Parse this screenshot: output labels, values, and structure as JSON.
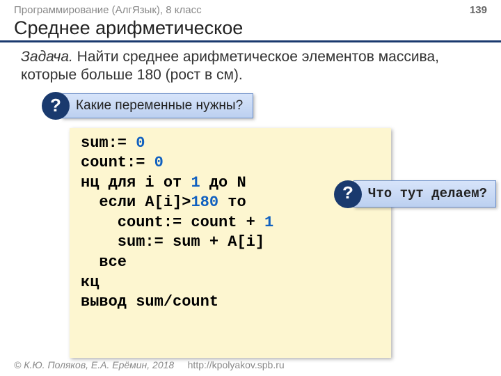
{
  "header": {
    "course": "Программирование (АлгЯзык), 8 класс",
    "page": "139"
  },
  "title": "Среднее арифметическое",
  "task": {
    "label": "Задача.",
    "text": " Найти среднее арифметическое элементов массива, которые больше 180 (рост в см)."
  },
  "callout1": {
    "badge": "?",
    "text": "Какие переменные нужны?"
  },
  "code": {
    "l1a": "sum:= ",
    "l1b": "0",
    "l2a": "count:= ",
    "l2b": "0",
    "l3a": "нц для i от ",
    "l3b": "1",
    "l3c": " до N",
    "l4a": "  если A[i]>",
    "l4b": "180",
    "l4c": " то",
    "l5a": "    count:= count + ",
    "l5b": "1",
    "l6": "    sum:= sum + A[i]",
    "l7": "  все",
    "l8": "кц",
    "l9": "вывод sum/count"
  },
  "callout2": {
    "badge": "?",
    "text": "Что тут делаем?"
  },
  "footer": {
    "authors": "© К.Ю. Поляков, Е.А. Ерёмин, 2018",
    "url": "http://kpolyakov.spb.ru"
  }
}
